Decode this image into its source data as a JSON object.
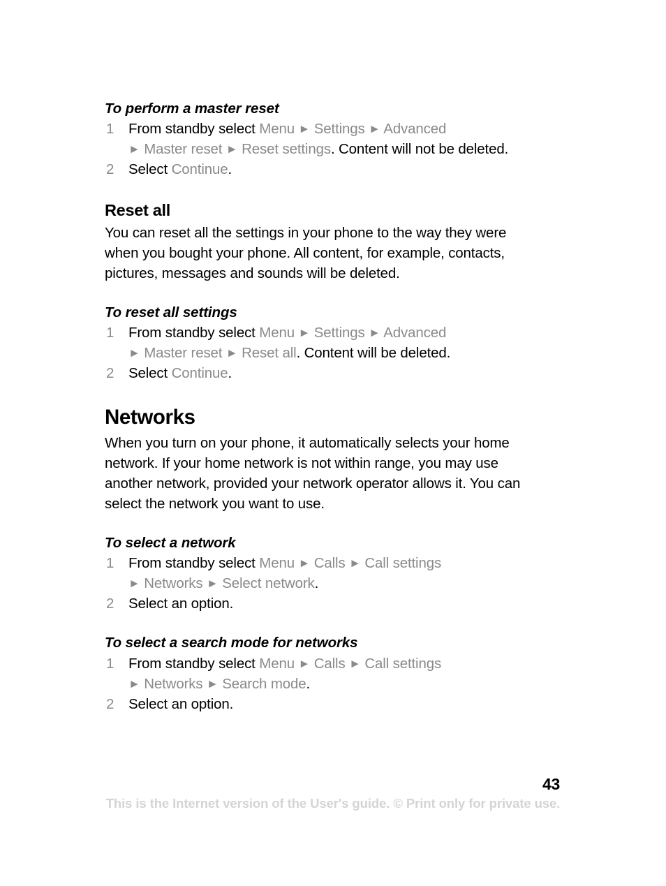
{
  "document": {
    "page_number": "43",
    "footer_note": "This is the Internet version of the User's guide. © Print only for private use.",
    "arrow_glyph": "►"
  },
  "sections": {
    "master_reset": {
      "heading": "To perform a master reset",
      "step1": {
        "number": "1",
        "lead": "From standby select ",
        "menu1": "Menu",
        "menu2": "Settings",
        "menu3": "Advanced",
        "menu4": "Master reset",
        "menu5": "Reset settings",
        "tail": ". Content will not be deleted."
      },
      "step2": {
        "number": "2",
        "lead": "Select ",
        "menu1": "Continue",
        "tail": "."
      }
    },
    "reset_all": {
      "heading": "Reset all",
      "body": "You can reset all the settings in your phone to the way they were when you bought your phone. All content, for example, contacts, pictures, messages and sounds will be deleted."
    },
    "reset_all_settings": {
      "heading": "To reset all settings",
      "step1": {
        "number": "1",
        "lead": "From standby select ",
        "menu1": "Menu",
        "menu2": "Settings",
        "menu3": "Advanced",
        "menu4": "Master reset",
        "menu5": "Reset all",
        "tail": ". Content will be deleted."
      },
      "step2": {
        "number": "2",
        "lead": "Select ",
        "menu1": "Continue",
        "tail": "."
      }
    },
    "networks": {
      "heading": "Networks",
      "body": "When you turn on your phone, it automatically selects your home network. If your home network is not within range, you may use another network, provided your network operator allows it. You can select the network you want to use."
    },
    "select_network": {
      "heading": "To select a network",
      "step1": {
        "number": "1",
        "lead": "From standby select ",
        "menu1": "Menu",
        "menu2": "Calls",
        "menu3": "Call settings",
        "menu4": "Networks",
        "menu5": "Select network",
        "tail": "."
      },
      "step2": {
        "number": "2",
        "text": "Select an option."
      }
    },
    "search_mode": {
      "heading": "To select a search mode for networks",
      "step1": {
        "number": "1",
        "lead": "From standby select ",
        "menu1": "Menu",
        "menu2": "Calls",
        "menu3": "Call settings",
        "menu4": "Networks",
        "menu5": "Search mode",
        "tail": "."
      },
      "step2": {
        "number": "2",
        "text": "Select an option."
      }
    }
  }
}
